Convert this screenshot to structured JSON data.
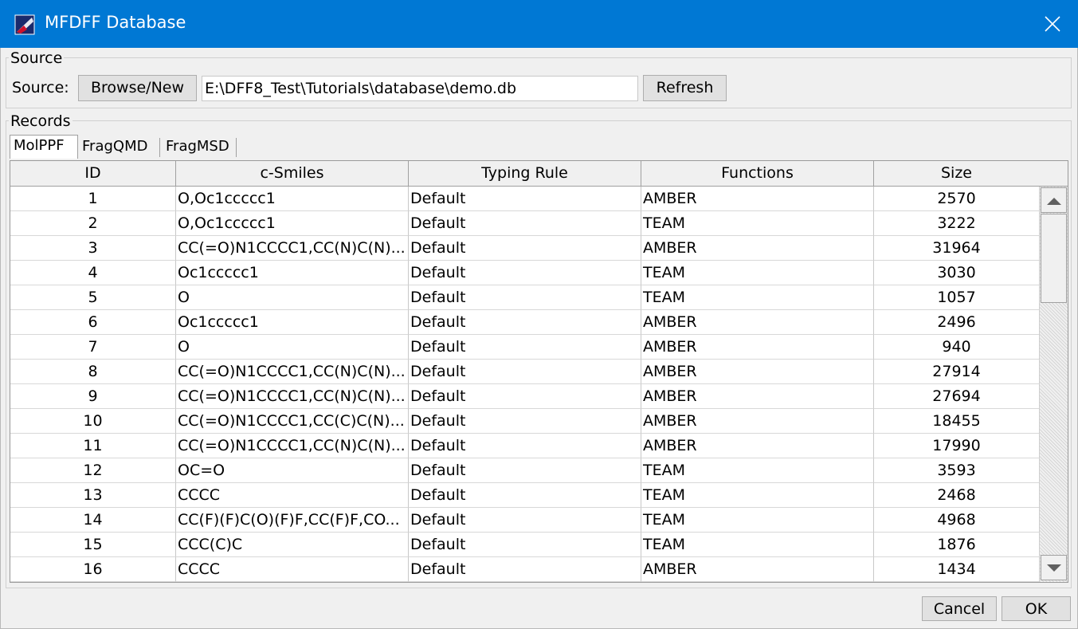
{
  "window": {
    "title": "MFDFF Database",
    "accent_color": "#0078d4",
    "icon": "app-logo-icon",
    "close_icon": "close-icon"
  },
  "source_group": {
    "title": "Source",
    "label": "Source:",
    "browse_label": "Browse/New",
    "path_value": "E:\\DFF8_Test\\Tutorials\\database\\demo.db",
    "refresh_label": "Refresh"
  },
  "records_group": {
    "title": "Records",
    "tabs": [
      {
        "label": "MolPPF",
        "active": true
      },
      {
        "label": "FragQMD",
        "active": false
      },
      {
        "label": "FragMSD",
        "active": false
      }
    ]
  },
  "table": {
    "columns": [
      "ID",
      "c-Smiles",
      "Typing Rule",
      "Functions",
      "Size"
    ],
    "rows": [
      [
        "1",
        "O,Oc1ccccc1",
        "Default",
        "AMBER",
        "2570"
      ],
      [
        "2",
        "O,Oc1ccccc1",
        "Default",
        "TEAM",
        "3222"
      ],
      [
        "3",
        "CC(=O)N1CCCC1,CC(N)C(N)...",
        "Default",
        "AMBER",
        "31964"
      ],
      [
        "4",
        "Oc1ccccc1",
        "Default",
        "TEAM",
        "3030"
      ],
      [
        "5",
        "O",
        "Default",
        "TEAM",
        "1057"
      ],
      [
        "6",
        "Oc1ccccc1",
        "Default",
        "AMBER",
        "2496"
      ],
      [
        "7",
        "O",
        "Default",
        "AMBER",
        "940"
      ],
      [
        "8",
        "CC(=O)N1CCCC1,CC(N)C(N)...",
        "Default",
        "AMBER",
        "27914"
      ],
      [
        "9",
        "CC(=O)N1CCCC1,CC(N)C(N)...",
        "Default",
        "AMBER",
        "27694"
      ],
      [
        "10",
        "CC(=O)N1CCCC1,CC(C)C(N)...",
        "Default",
        "AMBER",
        "18455"
      ],
      [
        "11",
        "CC(=O)N1CCCC1,CC(N)C(N)...",
        "Default",
        "AMBER",
        "17990"
      ],
      [
        "12",
        "OC=O",
        "Default",
        "TEAM",
        "3593"
      ],
      [
        "13",
        "CCCC",
        "Default",
        "TEAM",
        "2468"
      ],
      [
        "14",
        "CC(F)(F)C(O)(F)F,CC(F)F,CO...",
        "Default",
        "TEAM",
        "4968"
      ],
      [
        "15",
        "CCC(C)C",
        "Default",
        "TEAM",
        "1876"
      ],
      [
        "16",
        "CCCC",
        "Default",
        "AMBER",
        "1434"
      ]
    ]
  },
  "footer": {
    "cancel_label": "Cancel",
    "ok_label": "OK"
  }
}
